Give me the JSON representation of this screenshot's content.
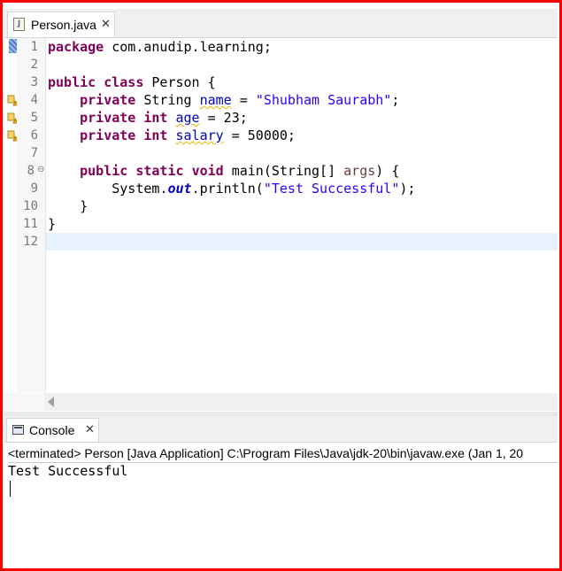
{
  "editor": {
    "tab_label": "Person.java",
    "tab_icon": "java-file-icon",
    "line_numbers": [
      "1",
      "2",
      "3",
      "4",
      "5",
      "6",
      "7",
      "8",
      "9",
      "10",
      "11",
      "12"
    ],
    "code": {
      "l1_kw": "package",
      "l1_rest": " com.anudip.learning;",
      "l3_kw1": "public",
      "l3_kw2": "class",
      "l3_rest": " Person {",
      "l4_kw": "private",
      "l4_type": " String ",
      "l4_field": "name",
      "l4_eq": " = ",
      "l4_str": "\"Shubham Saurabh\"",
      "l4_end": ";",
      "l5_kw1": "private",
      "l5_kw2": "int",
      "l5_field": "age",
      "l5_rest": " = 23;",
      "l6_kw1": "private",
      "l6_kw2": "int",
      "l6_field": "salary",
      "l6_rest": " = 50000;",
      "l8_kw1": "public",
      "l8_kw2": "static",
      "l8_kw3": "void",
      "l8_mid": " main(String[] ",
      "l8_param": "args",
      "l8_end": ") {",
      "l9_pre": "System.",
      "l9_out": "out",
      "l9_mid": ".println(",
      "l9_str": "\"Test Successful\"",
      "l9_end": ");",
      "l10": "}",
      "l11": "}"
    }
  },
  "console": {
    "tab_label": "Console",
    "tab_icon": "console-icon",
    "status": "<terminated> Person [Java Application] C:\\Program Files\\Java\\jdk-20\\bin\\javaw.exe  (Jan 1, 20",
    "output": "Test Successful"
  },
  "colors": {
    "keyword": "#7f0055",
    "string": "#2a00ff",
    "field": "#0000c0",
    "frame_border": "#ff0000"
  }
}
